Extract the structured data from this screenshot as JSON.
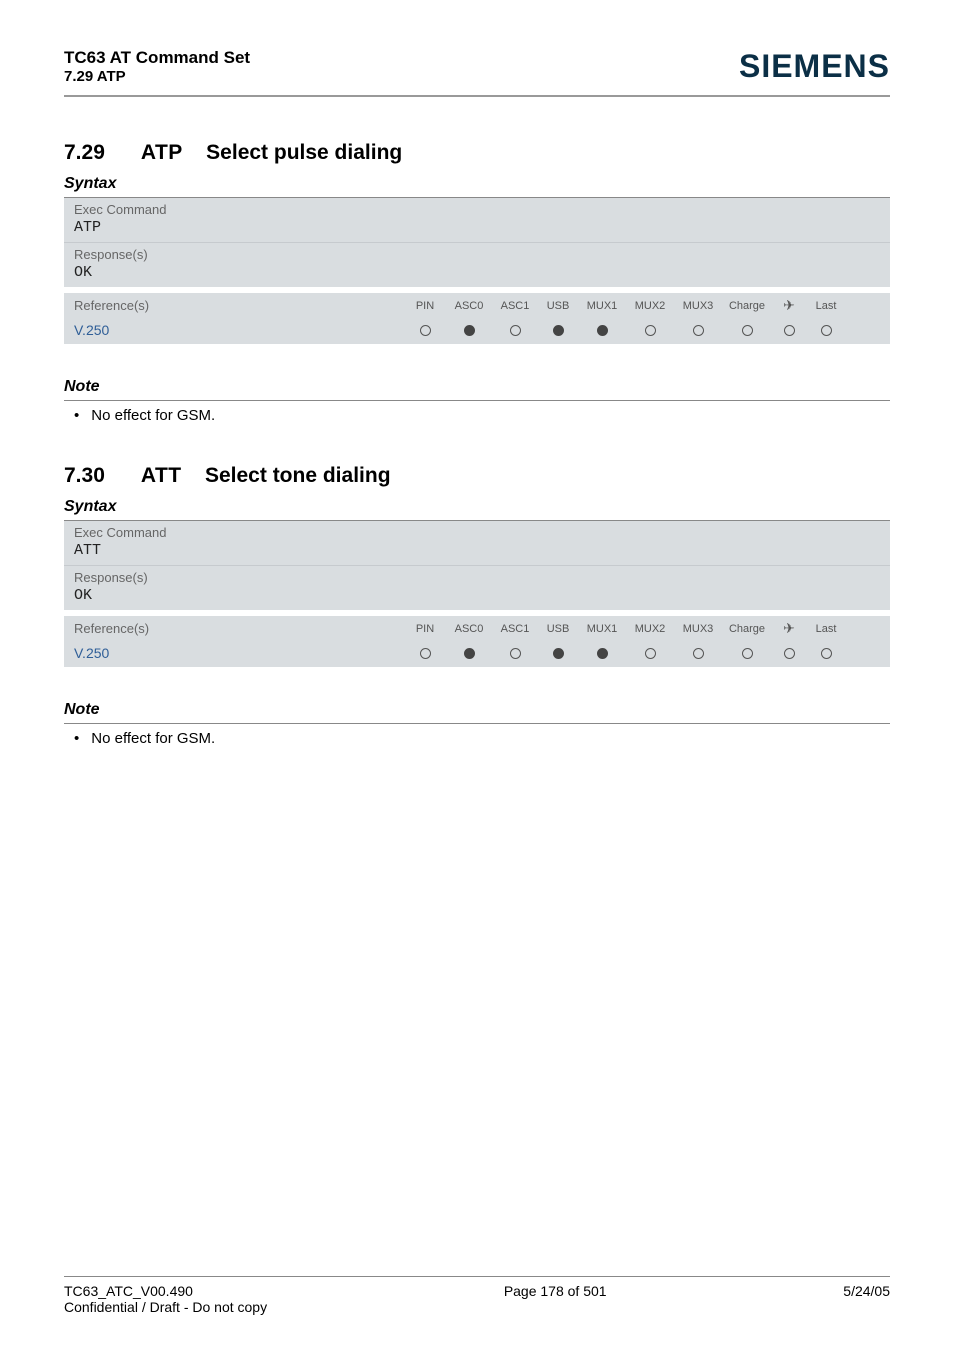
{
  "header": {
    "doc_title": "TC63 AT Command Set",
    "doc_sub": "7.29 ATP",
    "brand": "SIEMENS"
  },
  "sections": [
    {
      "num": "7.29",
      "cmd": "ATP",
      "title": "Select pulse dialing",
      "syntax_label": "Syntax",
      "exec_label": "Exec Command",
      "exec_cmd": "ATP",
      "resp_label": "Response(s)",
      "resp_val": "OK",
      "ref_label": "Reference(s)",
      "ref_val": "V.250",
      "cols": [
        "PIN",
        "ASC0",
        "ASC1",
        "USB",
        "MUX1",
        "MUX2",
        "MUX3",
        "Charge",
        "✈",
        "Last"
      ],
      "dots": [
        "open",
        "filled",
        "open",
        "filled",
        "filled",
        "open",
        "open",
        "open",
        "open",
        "open"
      ],
      "note_label": "Note",
      "note_items": [
        "No effect for GSM."
      ]
    },
    {
      "num": "7.30",
      "cmd": "ATT",
      "title": "Select tone dialing",
      "syntax_label": "Syntax",
      "exec_label": "Exec Command",
      "exec_cmd": "ATT",
      "resp_label": "Response(s)",
      "resp_val": "OK",
      "ref_label": "Reference(s)",
      "ref_val": "V.250",
      "cols": [
        "PIN",
        "ASC0",
        "ASC1",
        "USB",
        "MUX1",
        "MUX2",
        "MUX3",
        "Charge",
        "✈",
        "Last"
      ],
      "dots": [
        "open",
        "filled",
        "open",
        "filled",
        "filled",
        "open",
        "open",
        "open",
        "open",
        "open"
      ],
      "note_label": "Note",
      "note_items": [
        "No effect for GSM."
      ]
    }
  ],
  "footer": {
    "doc_id": "TC63_ATC_V00.490",
    "confidential": "Confidential / Draft - Do not copy",
    "page": "Page 178 of 501",
    "date": "5/24/05"
  }
}
